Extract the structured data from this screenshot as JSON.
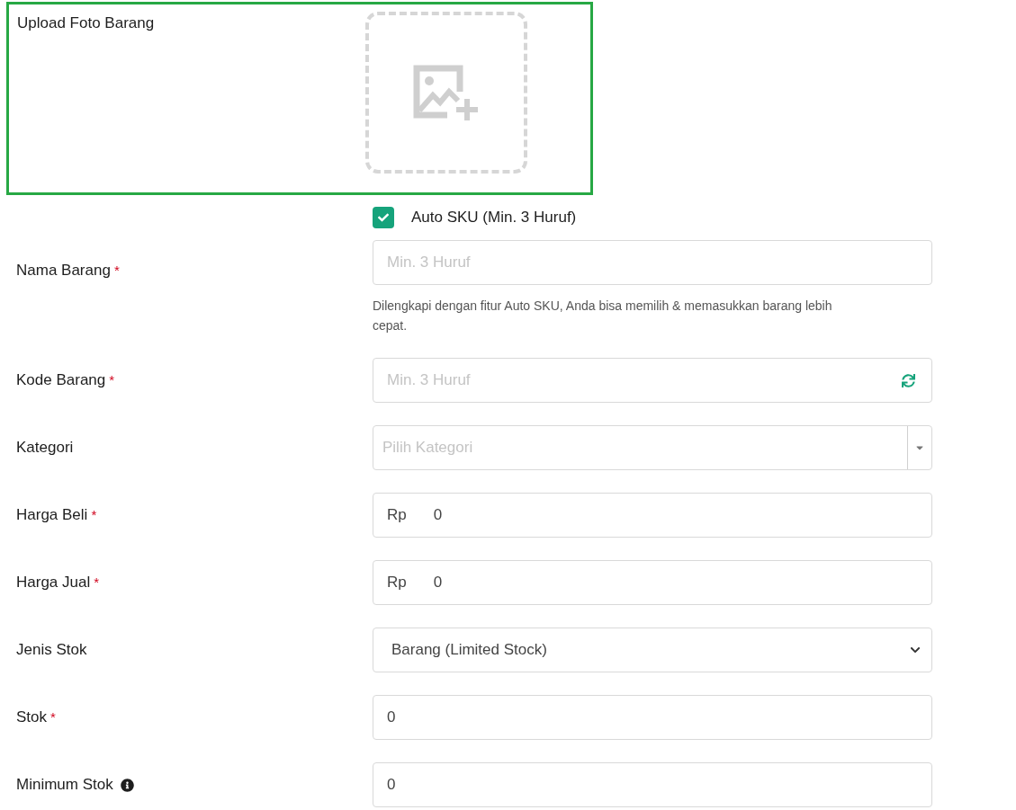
{
  "upload": {
    "label": "Upload Foto Barang",
    "highlighted": true
  },
  "auto_sku": {
    "label": "Auto SKU (Min. 3 Huruf)",
    "checked": true
  },
  "fields": [
    {
      "kind": "text",
      "label": "Nama Barang",
      "required_mark": "*",
      "placeholder": "Min. 3 Huruf",
      "help": "Dilengkapi dengan fitur Auto SKU, Anda bisa memilih & memasukkan barang lebih cepat."
    },
    {
      "kind": "refresh",
      "label": "Kode Barang",
      "required_mark": "*",
      "placeholder": "Min. 3 Huruf"
    },
    {
      "kind": "combo",
      "label": "Kategori",
      "placeholder": "Pilih Kategori"
    },
    {
      "kind": "currency",
      "label": "Harga Beli",
      "required_mark": "*",
      "prefix": "Rp",
      "value": "0"
    },
    {
      "kind": "currency",
      "label": "Harga Jual",
      "required_mark": "*",
      "prefix": "Rp",
      "value": "0"
    },
    {
      "kind": "select",
      "label": "Jenis Stok",
      "value": "Barang (Limited Stock)"
    },
    {
      "kind": "number",
      "label": "Stok",
      "required_mark": "*",
      "value": "0"
    },
    {
      "kind": "number",
      "label": "Minimum Stok",
      "info": true,
      "value": "0"
    }
  ]
}
